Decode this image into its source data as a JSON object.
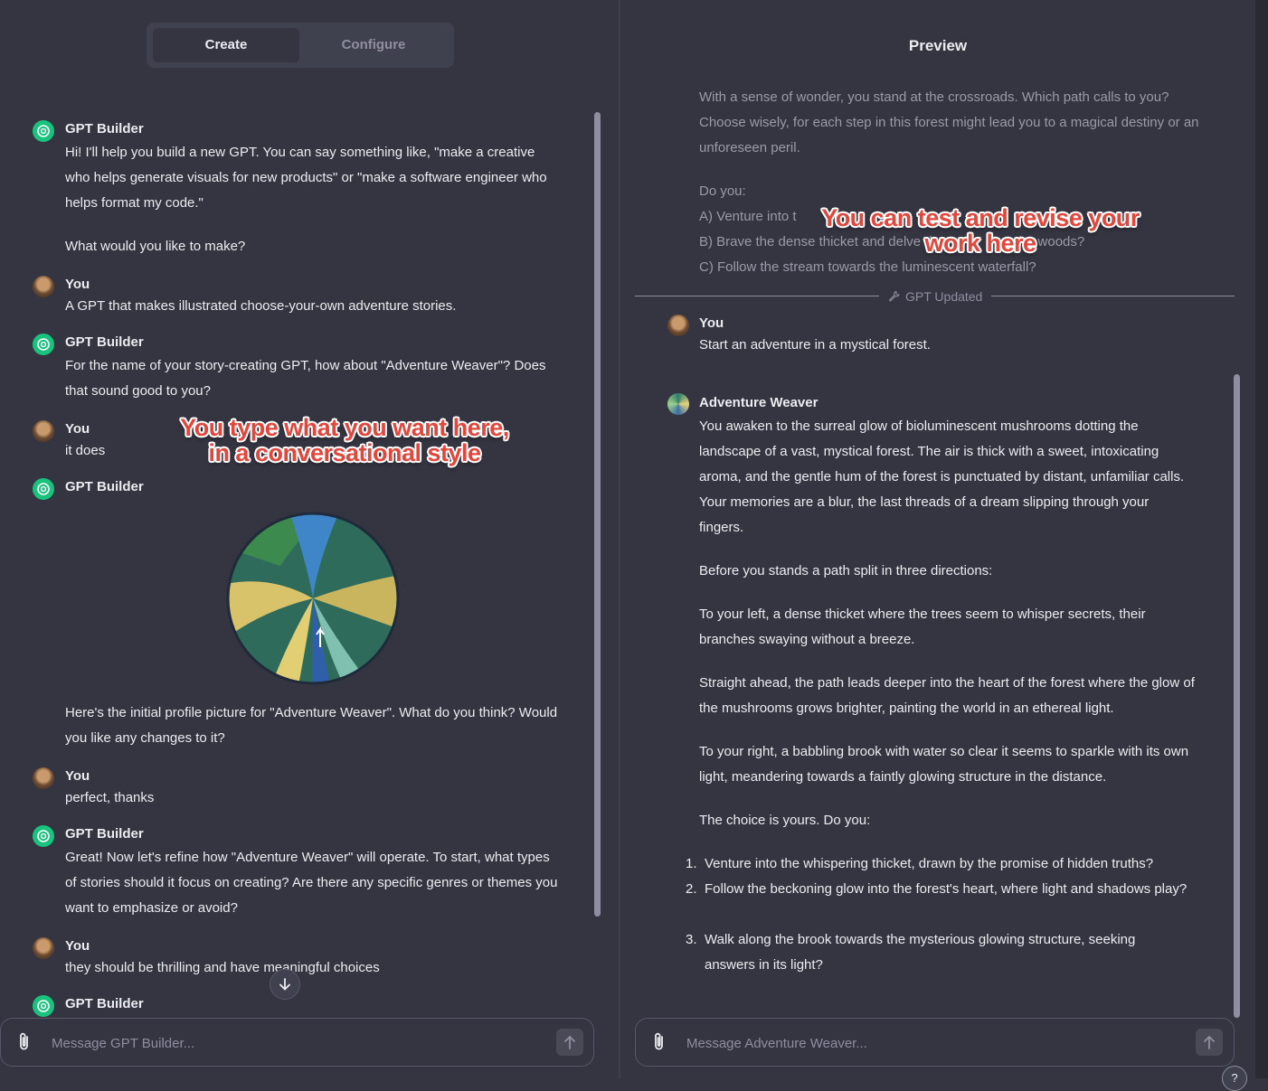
{
  "builder": {
    "tabs": [
      {
        "label": "Create",
        "active": true
      },
      {
        "label": "Configure",
        "active": false
      }
    ],
    "messages": [
      {
        "author": "GPT Builder",
        "role": "gpt",
        "paragraphs": [
          "Hi! I'll help you build a new GPT. You can say something like, \"make a creative who helps generate visuals for new products\" or \"make a software engineer who helps format my code.\"",
          "What would you like to make?"
        ]
      },
      {
        "author": "You",
        "role": "user",
        "paragraphs": [
          "A GPT that makes illustrated choose-your-own adventure stories."
        ]
      },
      {
        "author": "GPT Builder",
        "role": "gpt",
        "paragraphs": [
          "For the name of your story-creating GPT, how about \"Adventure Weaver\"? Does that sound good to you?"
        ]
      },
      {
        "author": "You",
        "role": "user",
        "paragraphs": [
          "it does"
        ]
      },
      {
        "author": "GPT Builder",
        "role": "gpt",
        "paragraphs": [
          "Here's the initial profile picture for \"Adventure Weaver\". What do you think? Would you like any changes to it?"
        ]
      },
      {
        "author": "You",
        "role": "user",
        "paragraphs": [
          "perfect, thanks"
        ]
      },
      {
        "author": "GPT Builder",
        "role": "gpt",
        "paragraphs": [
          "Great! Now let's refine how \"Adventure Weaver\" will operate. To start, what types of stories should it focus on creating? Are there any specific genres or themes you want to emphasize or avoid?"
        ]
      },
      {
        "author": "You",
        "role": "user",
        "paragraphs": [
          "they should be thrilling and have meaningful choices"
        ]
      },
      {
        "author": "GPT Builder",
        "role": "gpt",
        "paragraphs": []
      }
    ],
    "composer_placeholder": "Message GPT Builder...",
    "annotation": "You type what you want here, in a conversational style"
  },
  "preview": {
    "title": "Preview",
    "faded_story": {
      "intro": "With a sense of wonder, you stand at the crossroads. Which path calls to you? Choose wisely, for each step in this forest might lead you to a magical destiny or an unforeseen peril.",
      "prompt": "Do you:",
      "options": [
        "A) Venture into t",
        "B) Brave the dense thicket and delve de",
        "o the woods?",
        "C) Follow the stream towards the luminescent waterfall?"
      ]
    },
    "divider_label": "GPT Updated",
    "user_message": {
      "author": "You",
      "text": "Start an adventure in a mystical forest."
    },
    "reply": {
      "author": "Adventure Weaver",
      "paragraphs": [
        "You awaken to the surreal glow of bioluminescent mushrooms dotting the landscape of a vast, mystical forest. The air is thick with a sweet, intoxicating aroma, and the gentle hum of the forest is punctuated by distant, unfamiliar calls. Your memories are a blur, the last threads of a dream slipping through your fingers.",
        "Before you stands a path split in three directions:",
        "To your left, a dense thicket where the trees seem to whisper secrets, their branches swaying without a breeze.",
        "Straight ahead, the path leads deeper into the heart of the forest where the glow of the mushrooms grows brighter, painting the world in an ethereal light.",
        "To your right, a babbling brook with water so clear it seems to sparkle with its own light, meandering towards a faintly glowing structure in the distance.",
        "The choice is yours. Do you:"
      ],
      "choices": [
        "Venture into the whispering thicket, drawn by the promise of hidden truths?",
        "Follow the beckoning glow into the forest's heart, where light and shadows play?",
        "Walk along the brook towards the mysterious glowing structure, seeking answers in its light?"
      ]
    },
    "composer_placeholder": "Message Adventure Weaver...",
    "annotation": "You can test and revise your work here",
    "help_label": "?"
  },
  "colors": {
    "background": "#343541",
    "gpt_avatar": "#19c37d",
    "annotation": "#e0473d"
  },
  "icons": [
    "openai-logo-icon",
    "paperclip-icon",
    "arrow-up-icon",
    "arrow-down-icon",
    "wrench-icon"
  ]
}
